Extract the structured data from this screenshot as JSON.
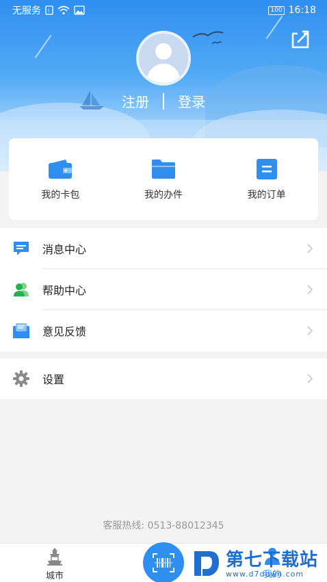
{
  "status_bar": {
    "carrier": "无服务",
    "battery": "100",
    "time": "16:18"
  },
  "header": {
    "register_label": "注册",
    "login_label": "登录",
    "share_icon": "share-icon",
    "avatar_icon": "default-avatar-icon"
  },
  "shortcuts": [
    {
      "label": "我的卡包",
      "icon": "wallet-icon",
      "color": "#2f8ff0"
    },
    {
      "label": "我的办件",
      "icon": "folder-icon",
      "color": "#2f8ff0"
    },
    {
      "label": "我的订单",
      "icon": "order-icon",
      "color": "#2f8ff0"
    }
  ],
  "menu": [
    {
      "label": "消息中心",
      "icon": "message-icon",
      "color": "#2f8ff0"
    },
    {
      "label": "帮助中心",
      "icon": "people-icon",
      "color": "#22b14c"
    },
    {
      "label": "意见反馈",
      "icon": "feedback-mail-icon",
      "color": "#2f8ff0"
    }
  ],
  "settings": {
    "label": "设置",
    "icon": "gear-icon",
    "color": "#8a8a8a"
  },
  "hotline": "客服热线: 0513-88012345",
  "tabbar": {
    "city_label": "城市",
    "mine_label": "我的",
    "scan_icon": "scan-icon"
  },
  "watermark": {
    "title": "第七下载站",
    "url": "www.d7down.com"
  },
  "colors": {
    "brand": "#2f8ff0",
    "background": "#f3f3f3"
  }
}
